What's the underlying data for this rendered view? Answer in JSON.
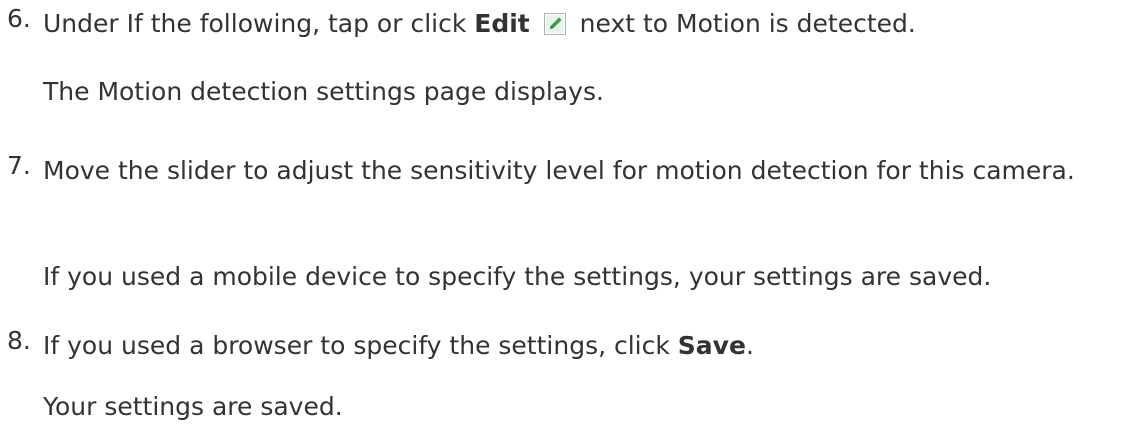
{
  "steps": [
    {
      "number": "6.",
      "pre": "Under If the following, tap or click ",
      "bold": "Edit",
      "icon": "edit-pencil-icon",
      "post": " next to Motion is detected.",
      "result": "The Motion detection settings page displays."
    },
    {
      "number": "7.",
      "text": "Move the slider to adjust the sensitivity level for motion detection for this camera.",
      "result": "If you used a mobile device to specify the settings, your settings are saved."
    },
    {
      "number": "8.",
      "pre": "If you used a browser to specify the settings, click ",
      "bold": "Save",
      "post": ".",
      "result": "Your settings are saved."
    }
  ],
  "colors": {
    "text": "#333333",
    "icon_bg": "#3aa047",
    "icon_border": "#b0b0b0"
  }
}
